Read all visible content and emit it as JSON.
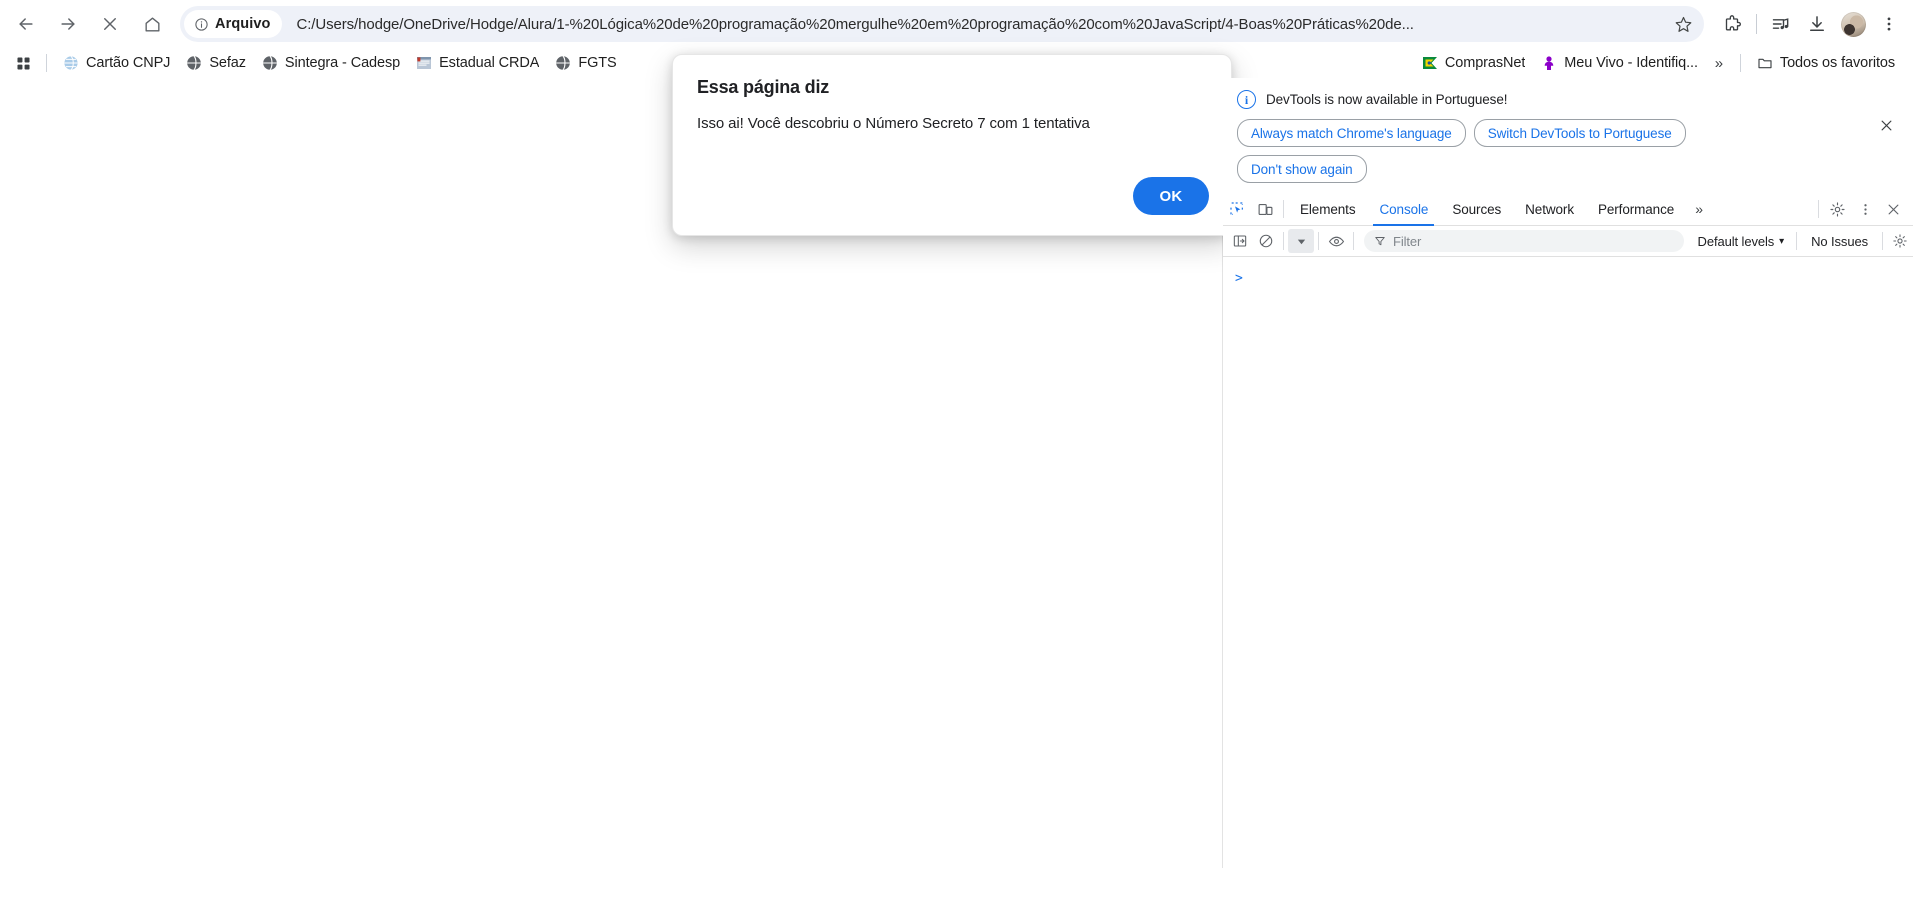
{
  "browser": {
    "nav": {
      "back": "Back",
      "forward": "Forward",
      "stop": "Stop",
      "home": "Home"
    },
    "omnibox": {
      "scheme_chip": "Arquivo",
      "url": "C:/Users/hodge/OneDrive/Hodge/Alura/1-%20Lógica%20de%20programação%20mergulhe%20em%20programação%20com%20JavaScript/4-Boas%20Práticas%20de...",
      "bookmark_star": "Bookmark this tab"
    },
    "toolbar_icons": [
      "extensions-icon",
      "media-control-icon",
      "downloads-icon",
      "profile-avatar",
      "chrome-menu-icon"
    ]
  },
  "bookmarks": {
    "apps_label": "Apps",
    "items": [
      {
        "label": "Cartão CNPJ",
        "favicon_color": "#8ab4d8"
      },
      {
        "label": "Sefaz",
        "favicon_color": "#5f6368"
      },
      {
        "label": "Sintegra - Cadesp",
        "favicon_color": "#5f6368"
      },
      {
        "label": "Estadual CRDA",
        "favicon_color": "#c0392b"
      },
      {
        "label": "FGTS",
        "favicon_color": "#5f6368"
      },
      {
        "label": "ComprasNet",
        "favicon_color": "#0a8a3c"
      },
      {
        "label": "Meu Vivo - Identifiq...",
        "favicon_color": "#8b00c9"
      }
    ],
    "overflow": "»",
    "all_bookmarks": "Todos os favoritos"
  },
  "dialog": {
    "title": "Essa página diz",
    "message": "Isso ai! Você descobriu o Número Secreto 7 com 1 tentativa",
    "ok_label": "OK",
    "accent_color": "#1a73e8"
  },
  "devtools": {
    "banner": {
      "text": "DevTools is now available in Portuguese!",
      "buttons": [
        "Always match Chrome's language",
        "Switch DevTools to Portuguese",
        "Don't show again"
      ],
      "close_label": "Close"
    },
    "tabs": [
      {
        "label": "Elements",
        "selected": false
      },
      {
        "label": "Console",
        "selected": true
      },
      {
        "label": "Sources",
        "selected": false
      },
      {
        "label": "Network",
        "selected": false
      },
      {
        "label": "Performance",
        "selected": false
      }
    ],
    "tabs_overflow": "»",
    "console_toolbar": {
      "filter_placeholder": "Filter",
      "levels": "Default levels",
      "levels_caret": "▾",
      "issues": "No Issues"
    },
    "console_prompt": ">",
    "accent_color": "#1a73e8"
  }
}
